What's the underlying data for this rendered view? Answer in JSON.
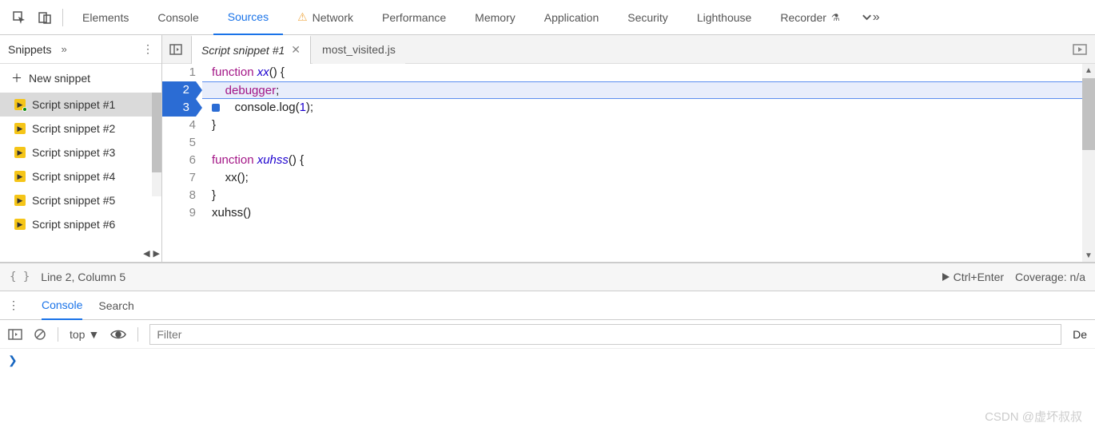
{
  "top_tabs": [
    "Elements",
    "Console",
    "Sources",
    "Network",
    "Performance",
    "Memory",
    "Application",
    "Security",
    "Lighthouse",
    "Recorder"
  ],
  "top_active": "Sources",
  "network_warning": true,
  "sidebar": {
    "title": "Snippets",
    "new_label": "New snippet",
    "items": [
      "Script snippet #1",
      "Script snippet #2",
      "Script snippet #3",
      "Script snippet #4",
      "Script snippet #5",
      "Script snippet #6"
    ],
    "selected_index": 0,
    "modified_index": 0
  },
  "file_tabs": {
    "active": "Script snippet #1",
    "others": [
      "most_visited.js"
    ]
  },
  "code": {
    "lines": [
      {
        "n": 1,
        "exec": false,
        "hl": false,
        "tokens": [
          {
            "t": "function ",
            "c": "kw"
          },
          {
            "t": "xx",
            "c": "fn"
          },
          {
            "t": "() {",
            "c": "plain"
          }
        ]
      },
      {
        "n": 2,
        "exec": true,
        "hl": true,
        "tokens": [
          {
            "t": "    ",
            "c": "plain"
          },
          {
            "t": "debugger",
            "c": "kw"
          },
          {
            "t": ";",
            "c": "plain"
          }
        ]
      },
      {
        "n": 3,
        "exec": true,
        "hl": false,
        "bp": true,
        "tokens": [
          {
            "t": "    ",
            "c": "plain"
          },
          {
            "t": "console.",
            "c": "plain"
          },
          {
            "t": "log",
            "c": "plain"
          },
          {
            "t": "(",
            "c": "plain"
          },
          {
            "t": "1",
            "c": "num"
          },
          {
            "t": ");",
            "c": "plain"
          }
        ]
      },
      {
        "n": 4,
        "exec": false,
        "hl": false,
        "tokens": [
          {
            "t": "}",
            "c": "plain"
          }
        ]
      },
      {
        "n": 5,
        "exec": false,
        "hl": false,
        "tokens": [
          {
            "t": "",
            "c": "plain"
          }
        ]
      },
      {
        "n": 6,
        "exec": false,
        "hl": false,
        "tokens": [
          {
            "t": "function ",
            "c": "kw"
          },
          {
            "t": "xuhss",
            "c": "fn"
          },
          {
            "t": "() {",
            "c": "plain"
          }
        ]
      },
      {
        "n": 7,
        "exec": false,
        "hl": false,
        "tokens": [
          {
            "t": "    xx();",
            "c": "plain"
          }
        ]
      },
      {
        "n": 8,
        "exec": false,
        "hl": false,
        "tokens": [
          {
            "t": "}",
            "c": "plain"
          }
        ]
      },
      {
        "n": 9,
        "exec": false,
        "hl": false,
        "tokens": [
          {
            "t": "xuhss()",
            "c": "plain"
          }
        ]
      }
    ]
  },
  "status": {
    "cursor": "Line 2, Column 5",
    "run_hint": "Ctrl+Enter",
    "coverage": "Coverage: n/a"
  },
  "drawer": {
    "tabs": [
      "Console",
      "Search"
    ],
    "active": "Console",
    "context": "top",
    "filter_placeholder": "Filter",
    "de_label": "De",
    "prompt": "❯"
  },
  "watermark": "CSDN @虚坏叔叔"
}
